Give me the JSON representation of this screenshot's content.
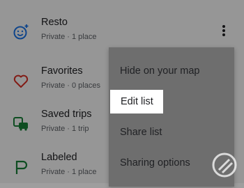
{
  "lists": [
    {
      "title": "Resto",
      "subtitle": "Private · 1 place",
      "icon": "smiley-icon"
    },
    {
      "title": "Favorites",
      "subtitle": "Private · 0 places",
      "icon": "heart-icon"
    },
    {
      "title": "Saved trips",
      "subtitle": "Private · 1 trip",
      "icon": "trips-icon"
    },
    {
      "title": "Labeled",
      "subtitle": "Private · 1 place",
      "icon": "flag-icon"
    }
  ],
  "menu": {
    "items": [
      "Hide on your map",
      "Edit list",
      "Share list",
      "Sharing options"
    ]
  },
  "colors": {
    "accent": "#1a73e8",
    "favorites": "#d93025",
    "scrim": "rgba(0,0,0,0.4)"
  }
}
